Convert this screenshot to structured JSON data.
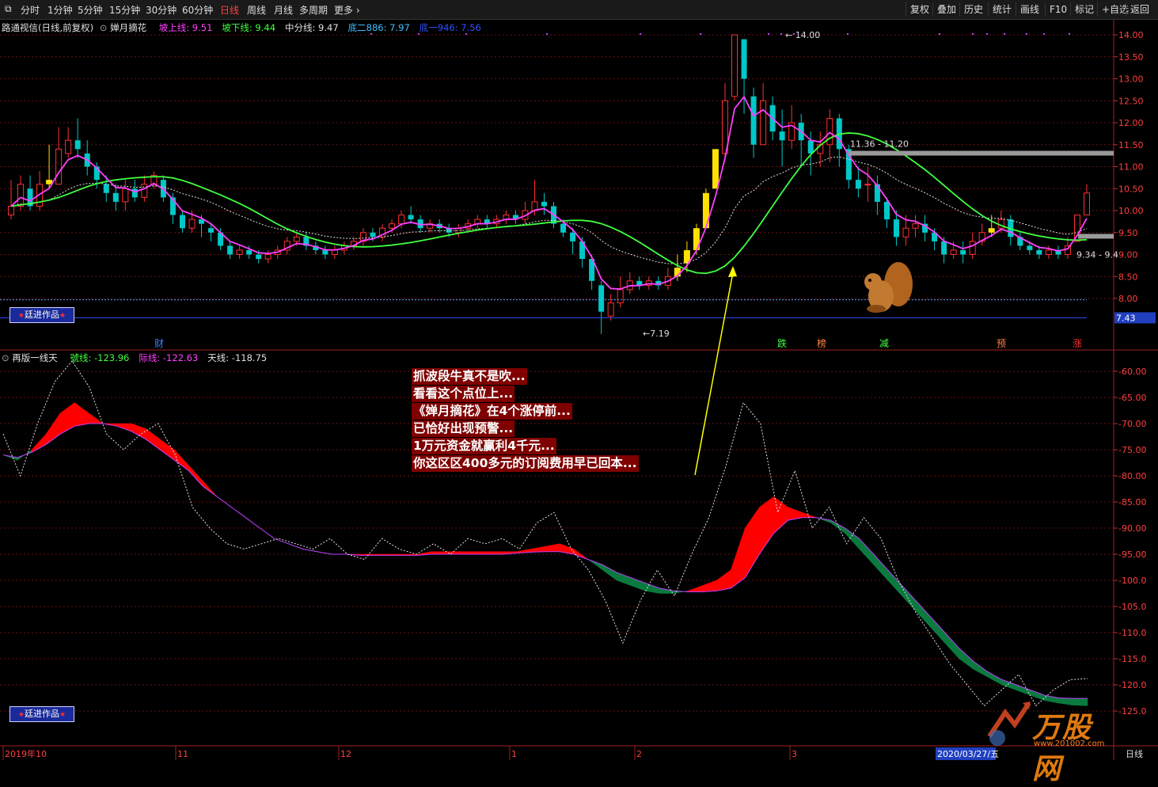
{
  "toolbar": {
    "periods": [
      "分时",
      "1分钟",
      "5分钟",
      "15分钟",
      "30分钟",
      "60分钟",
      "日线",
      "周线",
      "月线",
      "多周期",
      "更多"
    ],
    "active_period": "日线",
    "right_buttons": [
      "复权",
      "叠加",
      "历史",
      "统计",
      "画线",
      "F10",
      "标记",
      "+自选",
      "返回"
    ]
  },
  "main_header": {
    "stock": "路通视信(日线,前复权)",
    "indicator": "婵月摘花",
    "items": [
      {
        "label": "坡上线: 9.51",
        "color": "#ff40ff"
      },
      {
        "label": "坡下线: 9.44",
        "color": "#40ff40"
      },
      {
        "label": "中分线: 9.47",
        "color": "#e0e0e0"
      },
      {
        "label": "底二886: 7.97",
        "color": "#40c0ff"
      },
      {
        "label": "底一946: 7.56",
        "color": "#3050ff"
      }
    ]
  },
  "sub_header": {
    "indicator": "再版一线天",
    "items": [
      {
        "label": "號线: -123.96",
        "color": "#40ff40"
      },
      {
        "label": "际线: -122.63",
        "color": "#ff40ff"
      },
      {
        "label": "天线: -118.75",
        "color": "#e0e0e0"
      }
    ]
  },
  "price_axis": {
    "ticks": [
      "14.00",
      "13.50",
      "13.00",
      "12.50",
      "12.00",
      "11.50",
      "11.00",
      "10.50",
      "10.00",
      "9.50",
      "9.00",
      "8.50",
      "8.00"
    ],
    "current_tag": "7.43"
  },
  "sub_axis": {
    "ticks": [
      "-60.00",
      "-65.00",
      "-70.00",
      "-75.00",
      "-80.00",
      "-85.00",
      "-90.00",
      "-95.00",
      "-100.0",
      "-105.0",
      "-110.0",
      "-115.0",
      "-120.0",
      "-125.0"
    ]
  },
  "price_annotations": {
    "high": "14.00",
    "low": "7.19",
    "resistance": "11.36 - 11.20",
    "support": "9.34 - 9.4"
  },
  "event_markers": [
    {
      "label": "财",
      "color": "#4080ff"
    },
    {
      "label": "跌",
      "color": "#40ff40"
    },
    {
      "label": "榜",
      "color": "#ff8040"
    },
    {
      "label": "减",
      "color": "#40ff40"
    },
    {
      "label": "预",
      "color": "#ff8040"
    },
    {
      "label": "涨",
      "color": "#ff3030"
    }
  ],
  "date_axis": {
    "labels": [
      "2019年10",
      "11",
      "12",
      "1",
      "2",
      "3"
    ],
    "cursor_date": "2020/03/27/五",
    "period_label": "日线"
  },
  "annotation_text": [
    "抓波段牛真不是吹...",
    "看看这个点位上...",
    "《婵月摘花》在4个涨停前...",
    "已恰好出现预警...",
    "1万元资金就赢利4千元...",
    "你这区区400多元的订阅费用早已回本..."
  ],
  "badge_label": "廷进作品",
  "watermark": {
    "text": "万股网",
    "url": "www.201002.com"
  },
  "colors": {
    "up": "#ff3030",
    "down": "#00c8c8",
    "limit_up": "#ffe000",
    "upper_line": "#ff40ff",
    "lower_line": "#40ff40",
    "mid_line": "#e0e0e0",
    "red_fill": "#ff0000",
    "green_fill": "#0a7a3e",
    "grid": "#6a1010"
  },
  "chart_data": {
    "type": "candlestick",
    "price_range": [
      7.0,
      14.2
    ],
    "candles": [
      [
        9.9,
        10.1,
        10.7,
        9.8
      ],
      [
        10.1,
        10.6,
        10.8,
        10.0
      ],
      [
        10.5,
        10.1,
        10.8,
        10.0
      ],
      [
        10.1,
        10.6,
        10.9,
        10.0
      ],
      [
        10.6,
        10.7,
        11.5,
        10.5
      ],
      [
        10.6,
        11.4,
        11.9,
        10.9
      ],
      [
        11.3,
        11.6,
        11.9,
        11.2
      ],
      [
        11.6,
        11.4,
        12.1,
        11.2
      ],
      [
        11.3,
        11.0,
        11.6,
        10.8
      ],
      [
        11.0,
        10.7,
        11.1,
        10.5
      ],
      [
        10.6,
        10.4,
        10.8,
        10.2
      ],
      [
        10.4,
        10.2,
        10.6,
        10.0
      ],
      [
        10.2,
        10.5,
        10.7,
        10.0
      ],
      [
        10.5,
        10.3,
        10.7,
        10.2
      ],
      [
        10.3,
        10.6,
        10.8,
        10.2
      ],
      [
        10.6,
        10.8,
        10.9,
        10.5
      ],
      [
        10.7,
        10.3,
        10.8,
        10.2
      ],
      [
        10.3,
        9.9,
        10.4,
        9.7
      ],
      [
        9.9,
        9.6,
        10.0,
        9.5
      ],
      [
        9.6,
        9.8,
        10.0,
        9.5
      ],
      [
        9.8,
        9.7,
        9.9,
        9.4
      ],
      [
        9.6,
        9.5,
        9.7,
        9.3
      ],
      [
        9.5,
        9.2,
        9.6,
        9.1
      ],
      [
        9.2,
        9.0,
        9.3,
        8.9
      ],
      [
        9.0,
        9.1,
        9.2,
        8.9
      ],
      [
        9.1,
        9.0,
        9.2,
        8.9
      ],
      [
        9.0,
        8.9,
        9.1,
        8.8
      ],
      [
        8.9,
        9.0,
        9.1,
        8.8
      ],
      [
        9.0,
        9.1,
        9.2,
        8.9
      ],
      [
        9.1,
        9.3,
        9.4,
        9.0
      ],
      [
        9.3,
        9.4,
        9.5,
        9.2
      ],
      [
        9.4,
        9.2,
        9.5,
        9.1
      ],
      [
        9.2,
        9.1,
        9.3,
        9.0
      ],
      [
        9.1,
        9.0,
        9.2,
        8.9
      ],
      [
        9.0,
        9.1,
        9.2,
        8.9
      ],
      [
        9.1,
        9.2,
        9.3,
        9.0
      ],
      [
        9.2,
        9.3,
        9.4,
        9.1
      ],
      [
        9.3,
        9.5,
        9.6,
        9.2
      ],
      [
        9.5,
        9.4,
        9.6,
        9.3
      ],
      [
        9.4,
        9.6,
        9.7,
        9.3
      ],
      [
        9.6,
        9.7,
        9.8,
        9.5
      ],
      [
        9.7,
        9.9,
        10.0,
        9.6
      ],
      [
        9.9,
        9.8,
        10.1,
        9.7
      ],
      [
        9.8,
        9.6,
        9.9,
        9.5
      ],
      [
        9.6,
        9.7,
        9.8,
        9.5
      ],
      [
        9.7,
        9.6,
        9.8,
        9.5
      ],
      [
        9.6,
        9.5,
        9.7,
        9.4
      ],
      [
        9.5,
        9.6,
        9.7,
        9.4
      ],
      [
        9.6,
        9.7,
        9.8,
        9.5
      ],
      [
        9.7,
        9.8,
        9.9,
        9.6
      ],
      [
        9.8,
        9.7,
        9.9,
        9.6
      ],
      [
        9.7,
        9.8,
        9.9,
        9.6
      ],
      [
        9.8,
        9.9,
        10.0,
        9.7
      ],
      [
        9.9,
        9.8,
        10.0,
        9.7
      ],
      [
        9.8,
        10.0,
        10.2,
        9.7
      ],
      [
        10.0,
        10.2,
        10.7,
        9.9
      ],
      [
        10.2,
        10.1,
        10.4,
        9.9
      ],
      [
        10.1,
        9.7,
        10.2,
        9.6
      ],
      [
        9.7,
        9.5,
        9.8,
        9.4
      ],
      [
        9.5,
        9.3,
        9.6,
        9.0
      ],
      [
        9.3,
        8.9,
        9.4,
        8.7
      ],
      [
        8.9,
        8.4,
        9.0,
        8.2
      ],
      [
        8.3,
        7.7,
        8.4,
        7.19
      ],
      [
        7.6,
        7.9,
        8.1,
        7.5
      ],
      [
        7.9,
        8.2,
        8.5,
        7.8
      ],
      [
        8.2,
        8.4,
        8.6,
        8.1
      ],
      [
        8.4,
        8.3,
        8.5,
        8.2
      ],
      [
        8.3,
        8.4,
        8.5,
        8.2
      ],
      [
        8.4,
        8.3,
        8.5,
        8.2
      ],
      [
        8.3,
        8.5,
        8.7,
        8.2
      ],
      [
        8.5,
        8.7,
        9.0,
        8.4
      ],
      [
        8.8,
        9.1,
        9.3,
        8.6
      ],
      [
        9.1,
        9.6,
        9.7,
        9.0
      ],
      [
        9.6,
        10.4,
        10.5,
        9.6
      ],
      [
        10.5,
        11.4,
        11.4,
        10.5
      ],
      [
        11.3,
        12.5,
        12.9,
        11.2
      ],
      [
        12.6,
        14.0,
        14.0,
        12.5
      ],
      [
        13.9,
        13.0,
        13.6,
        12.2
      ],
      [
        12.6,
        11.5,
        12.8,
        11.2
      ],
      [
        11.5,
        12.5,
        12.9,
        11.5
      ],
      [
        12.4,
        11.8,
        12.6,
        11.6
      ],
      [
        11.8,
        11.6,
        12.3,
        11.0
      ],
      [
        11.6,
        12.0,
        12.4,
        11.4
      ],
      [
        12.0,
        11.6,
        12.2,
        11.0
      ],
      [
        11.6,
        11.3,
        11.8,
        10.8
      ],
      [
        11.3,
        11.5,
        11.8,
        11.0
      ],
      [
        11.5,
        12.1,
        12.3,
        11.1
      ],
      [
        12.1,
        11.4,
        12.2,
        11.0
      ],
      [
        11.4,
        10.7,
        11.5,
        10.5
      ],
      [
        10.7,
        10.5,
        11.0,
        10.3
      ],
      [
        10.6,
        10.6,
        11.0,
        10.2
      ],
      [
        10.6,
        10.2,
        10.8,
        9.9
      ],
      [
        10.2,
        9.8,
        10.3,
        9.6
      ],
      [
        9.8,
        9.4,
        10.0,
        9.2
      ],
      [
        9.4,
        9.6,
        9.9,
        9.2
      ],
      [
        9.6,
        9.7,
        9.9,
        9.4
      ],
      [
        9.7,
        9.5,
        9.9,
        9.3
      ],
      [
        9.5,
        9.3,
        9.6,
        9.1
      ],
      [
        9.3,
        9.0,
        9.4,
        8.8
      ],
      [
        9.0,
        9.1,
        9.3,
        8.9
      ],
      [
        9.1,
        9.0,
        9.3,
        8.8
      ],
      [
        9.0,
        9.3,
        9.5,
        8.9
      ],
      [
        9.3,
        9.5,
        9.7,
        9.2
      ],
      [
        9.5,
        9.6,
        9.9,
        9.4
      ],
      [
        9.6,
        9.8,
        10.0,
        9.5
      ],
      [
        9.8,
        9.4,
        9.9,
        9.2
      ],
      [
        9.4,
        9.2,
        9.5,
        9.1
      ],
      [
        9.2,
        9.1,
        9.3,
        9.0
      ],
      [
        9.1,
        9.0,
        9.2,
        8.9
      ],
      [
        9.0,
        9.1,
        9.2,
        8.9
      ],
      [
        9.1,
        9.0,
        9.2,
        8.9
      ],
      [
        9.0,
        9.2,
        9.4,
        8.9
      ],
      [
        9.3,
        9.9,
        9.9,
        9.3
      ],
      [
        9.9,
        10.4,
        10.6,
        9.9
      ]
    ],
    "limit_up_index": [
      4,
      70,
      71,
      72,
      73,
      74,
      103
    ]
  }
}
